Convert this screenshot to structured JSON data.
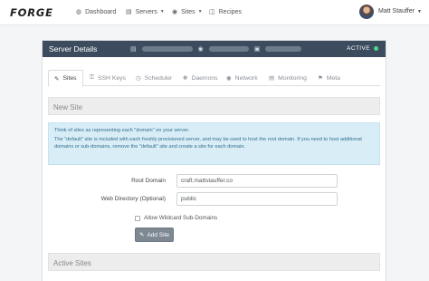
{
  "navbar": {
    "logo": "FORGE",
    "items": [
      {
        "label": "Dashboard",
        "icon": "dashboard-icon",
        "dropdown": false
      },
      {
        "label": "Servers",
        "icon": "server-icon",
        "dropdown": true
      },
      {
        "label": "Sites",
        "icon": "globe-icon",
        "dropdown": true
      },
      {
        "label": "Recipes",
        "icon": "book-icon",
        "dropdown": false
      }
    ],
    "user": "Matt Stauffer"
  },
  "panel": {
    "title": "Server Details",
    "status": "ACTIVE",
    "status_color": "#4cd98a"
  },
  "tabs": [
    {
      "label": "Sites",
      "icon": "edit-icon",
      "active": true
    },
    {
      "label": "SSH Keys",
      "icon": "key-icon",
      "active": false
    },
    {
      "label": "Scheduler",
      "icon": "clock-icon",
      "active": false
    },
    {
      "label": "Daemons",
      "icon": "cog-icon",
      "active": false
    },
    {
      "label": "Network",
      "icon": "network-icon",
      "active": false
    },
    {
      "label": "Monitoring",
      "icon": "chart-icon",
      "active": false
    },
    {
      "label": "Meta",
      "icon": "tag-icon",
      "active": false
    }
  ],
  "new_site": {
    "header": "New Site",
    "info_line1": "Think of sites as representing each \"domain\" on your server.",
    "info_line2": "The \"default\" site is included with each freshly provisioned server, and may be used to host the root domain. If you need to host additional domains or sub-domains, remove the \"default\" site and create a site for each domain.",
    "root_domain_label": "Root Domain",
    "root_domain_value": "craft.mattstauffer.co",
    "web_dir_label": "Web Directory (Optional)",
    "web_dir_value": "public",
    "wildcard_label": "Allow Wildcard Sub-Domains",
    "add_button": "Add Site"
  },
  "active_sites": {
    "header": "Active Sites"
  }
}
